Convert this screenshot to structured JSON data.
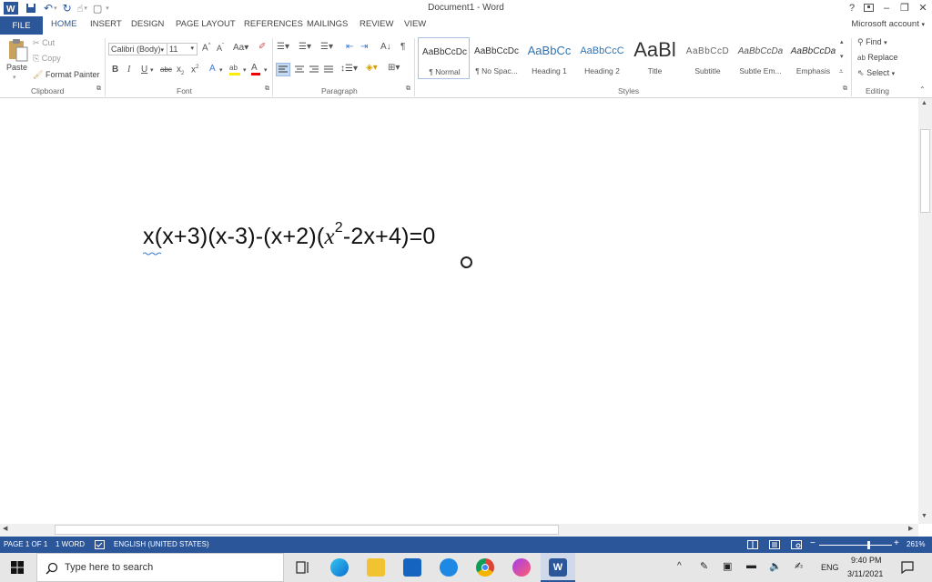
{
  "window": {
    "title": "Document1 - Word",
    "help": "?",
    "minimize": "–",
    "restore": "❐",
    "close": "✕"
  },
  "tabs": {
    "file": "FILE",
    "items": [
      "HOME",
      "INSERT",
      "DESIGN",
      "PAGE LAYOUT",
      "REFERENCES",
      "MAILINGS",
      "REVIEW",
      "VIEW"
    ],
    "account": "Microsoft account"
  },
  "ribbon": {
    "clipboard": {
      "paste": "Paste",
      "cut": "Cut",
      "copy": "Copy",
      "format_painter": "Format Painter",
      "group": "Clipboard"
    },
    "font": {
      "name": "Calibri (Body)",
      "size": "11",
      "group": "Font"
    },
    "paragraph": {
      "group": "Paragraph"
    },
    "styles": {
      "group": "Styles",
      "items": [
        {
          "sample": "AaBbCcDc",
          "name": "¶ Normal"
        },
        {
          "sample": "AaBbCcDc",
          "name": "¶ No Spac..."
        },
        {
          "sample": "AaBbCc",
          "name": "Heading 1"
        },
        {
          "sample": "AaBbCcC",
          "name": "Heading 2"
        },
        {
          "sample": "AaBl",
          "name": "Title"
        },
        {
          "sample": "AaBbCcD",
          "name": "Subtitle"
        },
        {
          "sample": "AaBbCcDa",
          "name": "Subtle Em..."
        },
        {
          "sample": "AaBbCcDa",
          "name": "Emphasis"
        }
      ]
    },
    "editing": {
      "find": "Find",
      "replace": "Replace",
      "select": "Select",
      "group": "Editing"
    }
  },
  "document": {
    "equation_part1": "x(x+3)(x-3)-(x+2)(",
    "equation_var": "x",
    "equation_exp": "2",
    "equation_part2": "-2x+4)=0"
  },
  "statusbar": {
    "page": "PAGE 1 OF 1",
    "words": "1 WORD",
    "language": "ENGLISH (UNITED STATES)",
    "zoom": "261%"
  },
  "taskbar": {
    "search_placeholder": "Type here to search",
    "language": "ENG",
    "time": "9:40 PM",
    "date": "3/11/2021"
  },
  "colors": {
    "accent": "#2b579a",
    "taskbar": "#e6e6e6"
  }
}
